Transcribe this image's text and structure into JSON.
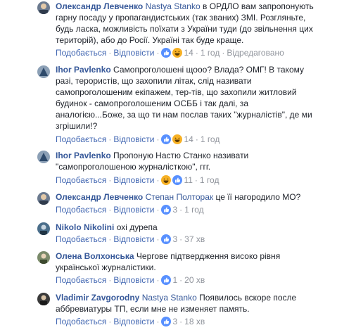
{
  "labels": {
    "like": "Подобається",
    "reply": "Відповісти",
    "sep": "·"
  },
  "comments": [
    {
      "author": "Олександр Левченко",
      "mention": "Nastya Stanko",
      "lines": [
        "в ОРДЛО вам запропонують",
        "гарну посаду у пропагандистських (так званих) ЗМІ. Розгляньте,",
        "будь ласка, можливість поїхати з України туди (до звільнення цих",
        "територій), або до Росії. Україні так буде краще."
      ],
      "reactions": [
        "like-icon",
        "haha-icon"
      ],
      "count": "14",
      "time": "1 год",
      "edited": "Відредаговано"
    },
    {
      "author": "Ihor Pavlenko",
      "mention": "",
      "lines": [
        "Самопроголошені щоoo? Влада? ОМГ! В такому",
        "разі, терористів, що захопили літак, слід називати",
        "самопроголошеним екіпажем, тер-тів, що захопили житловий",
        "будинок - самопроголошеним ОСББ і так далі, за",
        "аналогією...Боже, за що ти нам послав таких \"журналістів\", де ми",
        "згрішили!?"
      ],
      "reactions": [
        "like-icon",
        "haha-icon"
      ],
      "count": "14",
      "time": "1 год",
      "edited": ""
    },
    {
      "author": "Ihor Pavlenko",
      "mention": "",
      "lines": [
        "Пропоную Настю Станко називати",
        "\"самопроголошеною журналісткою\", ггг."
      ],
      "reactions": [
        "haha-icon",
        "like-icon"
      ],
      "count": "11",
      "time": "1 год",
      "edited": ""
    },
    {
      "author": "Олександр Левченко",
      "mention": "Степан Полторак",
      "lines": [
        "це її нагородило МО?"
      ],
      "reactions": [
        "like-icon"
      ],
      "count": "3",
      "time": "1 год",
      "edited": ""
    },
    {
      "author": "Nikolo Nikolini",
      "mention": "",
      "lines": [
        "охі дурепа"
      ],
      "reactions": [
        "like-icon"
      ],
      "count": "3",
      "time": "37 хв",
      "edited": ""
    },
    {
      "author": "Олена Волхонська",
      "mention": "",
      "lines": [
        "Чергове підтвердження високо рівня",
        "української журналістики."
      ],
      "reactions": [
        "like-icon"
      ],
      "count": "1",
      "time": "20 хв",
      "edited": ""
    },
    {
      "author": "Vladimir Zavgorodny",
      "mention": "Nastya Stanko",
      "lines": [
        "Появилось вскоре после",
        "аббревиатуры ТП, если мне не изменяет память."
      ],
      "reactions": [
        "like-icon"
      ],
      "count": "3",
      "time": "18 хв",
      "edited": ""
    }
  ]
}
